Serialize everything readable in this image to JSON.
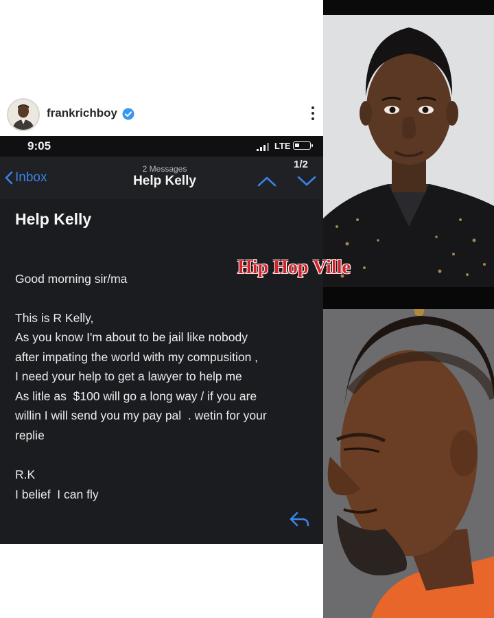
{
  "post": {
    "username": "frankrichboy",
    "verified": true
  },
  "status_bar": {
    "time": "9:05",
    "network": "LTE"
  },
  "mail_nav": {
    "back_label": "Inbox",
    "message_count": "2 Messages",
    "title": "Help Kelly",
    "page_indicator": "1/2"
  },
  "email": {
    "subject": "Help Kelly",
    "lines": [
      "Good morning sir/ma",
      "This is R Kelly,",
      "As you know I'm about to be jail like nobody",
      "after impating the world with my compusition ,",
      "I need your help to get a lawyer to help me",
      "As litle as  $100 will go a long way / if you are",
      "willin I will send you my pay pal  . wetin for your",
      "replie",
      "R.K",
      "I belief  I can fly"
    ]
  },
  "watermark": "Hip Hop Ville",
  "colors": {
    "accent_blue": "#3a84e8",
    "verified_blue": "#3897f0",
    "watermark_red": "#d2232a",
    "mail_background": "#1b1c20"
  },
  "icons": {
    "menu": "kebab-menu-icon",
    "back": "chevron-left-icon",
    "up": "chevron-up-icon",
    "down": "chevron-down-icon",
    "reply": "reply-icon"
  }
}
